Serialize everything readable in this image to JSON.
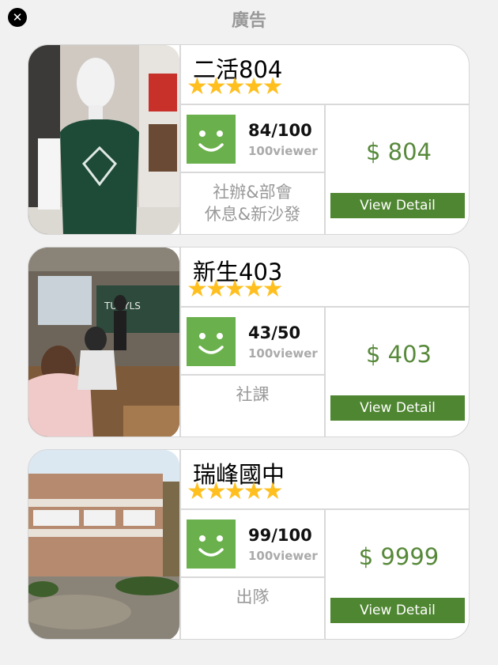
{
  "header": {
    "title": "廣告",
    "close_icon": "close-icon"
  },
  "colors": {
    "price": "#57893a",
    "button": "#4f8631",
    "star": "#ffbf1f",
    "smiley": "#6ab04c"
  },
  "cards": [
    {
      "name": "二活804",
      "stars": "★★★★★",
      "rating": 5,
      "score": "84/100",
      "viewer": "100viewer",
      "tags": [
        "社辦&部會",
        "休息&新沙發"
      ],
      "price": "$ 804",
      "button_label": "View Detail"
    },
    {
      "name": "新生403",
      "stars": "★★★★★",
      "rating": 5,
      "score": "43/50",
      "viewer": "100viewer",
      "tags": [
        "社課"
      ],
      "price": "$ 403",
      "button_label": "View Detail"
    },
    {
      "name": "瑞峰國中",
      "stars": "★★★★★",
      "rating": 5,
      "score": "99/100",
      "viewer": "100viewer",
      "tags": [
        "出隊"
      ],
      "price": "$ 9999",
      "button_label": "View Detail"
    }
  ]
}
